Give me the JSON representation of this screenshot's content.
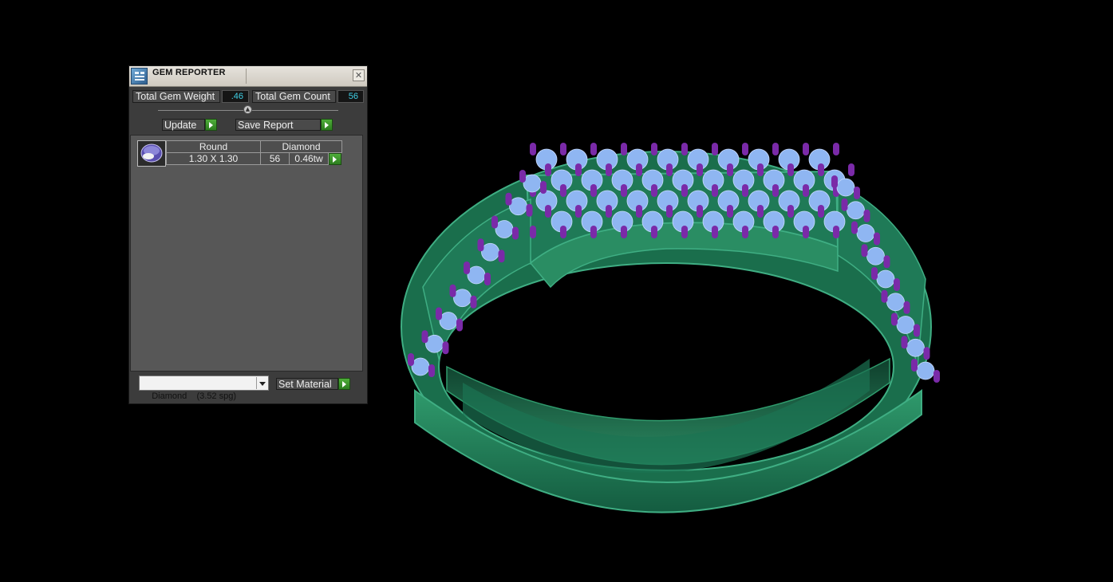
{
  "window": {
    "title": "GEM REPORTER",
    "close_glyph": "✕"
  },
  "summary": {
    "weight_label": "Total Gem Weight",
    "weight_value": ".46",
    "count_label": "Total Gem Count",
    "count_value": "56"
  },
  "actions": {
    "update_label": "Update",
    "save_label": "Save Report"
  },
  "gem_list": {
    "headers": [
      "Round",
      "Diamond"
    ],
    "rows": [
      {
        "size": "1.30 X 1.30",
        "count": "56",
        "weight": "0.46tw"
      }
    ]
  },
  "material": {
    "selected": "Diamond    (3.52 spg)",
    "set_label": "Set Material"
  },
  "colors": {
    "metal": "#1f7a57",
    "metal_highlight": "#3fae83",
    "gem": "#8fb6f2",
    "prong": "#7a2aa8",
    "value_text": "#3fd0e6",
    "go_button": "#3c9a2c"
  }
}
